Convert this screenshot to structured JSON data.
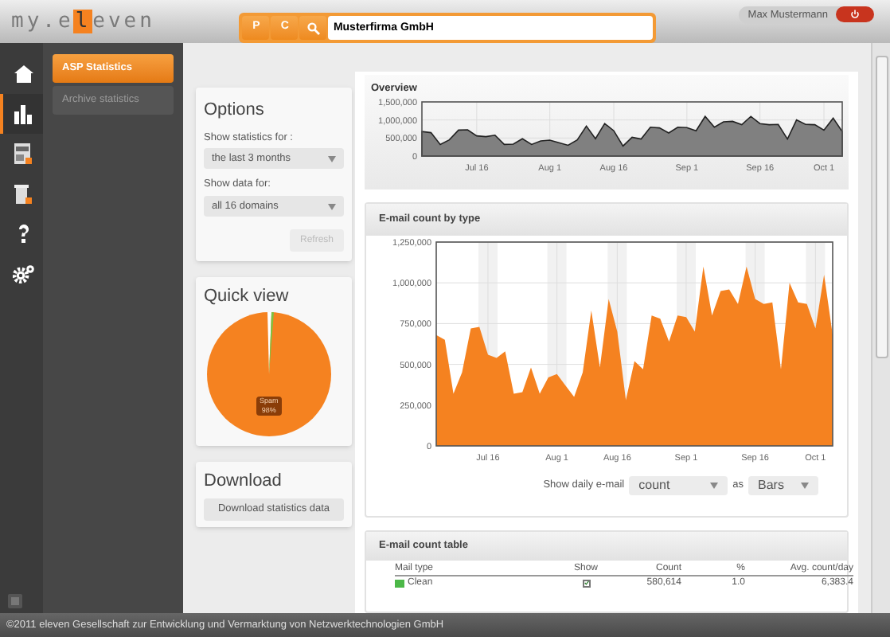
{
  "header": {
    "logo": {
      "before": "my.e",
      "mark": "l",
      "after": "even"
    },
    "search": {
      "buttons": [
        {
          "kind": "text",
          "label": "P"
        },
        {
          "kind": "text",
          "label": "C"
        },
        {
          "kind": "search"
        }
      ],
      "value": "Musterfirma GmbH"
    },
    "user": {
      "name": "Max Mustermann"
    }
  },
  "rail": [
    {
      "kind": "home",
      "selected": false
    },
    {
      "kind": "chart",
      "selected": true
    },
    {
      "kind": "report",
      "selected": false
    },
    {
      "kind": "trash",
      "selected": false
    },
    {
      "kind": "help",
      "selected": false
    },
    {
      "kind": "settings",
      "selected": false
    }
  ],
  "nav": [
    {
      "label": "ASP Statistics",
      "selected": true
    },
    {
      "label": "Archive statistics",
      "selected": false
    }
  ],
  "options": {
    "title": "Options",
    "fields": [
      {
        "label": "Show statistics for :",
        "value": "the last 3 months"
      },
      {
        "label": "Show data for:",
        "value": "all 16 domains"
      }
    ],
    "refresh": {
      "label": "Refresh",
      "disabled": true
    }
  },
  "quick_view": {
    "title": "Quick view",
    "tooltip": [
      "Spam",
      "98%"
    ]
  },
  "download": {
    "title": "Download",
    "button": "Download statistics data"
  },
  "overview": {
    "title": "Overview",
    "chart_data": {
      "type": "area",
      "categories": [
        null,
        null,
        null,
        null,
        null,
        null,
        "Jul 16",
        null,
        null,
        null,
        null,
        null,
        null,
        null,
        "Aug 1",
        null,
        null,
        null,
        null,
        null,
        null,
        "Aug 16",
        null,
        null,
        null,
        null,
        null,
        null,
        null,
        "Sep 1",
        null,
        null,
        null,
        null,
        null,
        null,
        null,
        "Sep 16",
        null,
        null,
        null,
        null,
        null,
        null,
        "Oct 1",
        null,
        null
      ],
      "series": [
        {
          "color": "#808080",
          "values": [
            680000,
            650000,
            320000,
            450000,
            720000,
            730000,
            560000,
            540000,
            580000,
            320000,
            330000,
            480000,
            320000,
            420000,
            440000,
            370000,
            300000,
            450000,
            830000,
            480000,
            900000,
            700000,
            280000,
            520000,
            470000,
            800000,
            780000,
            640000,
            800000,
            790000,
            700000,
            1100000,
            800000,
            950000,
            960000,
            870000,
            1100000,
            900000,
            870000,
            880000,
            470000,
            1000000,
            880000,
            870000,
            720000,
            1050000,
            680000
          ]
        }
      ],
      "ylim": [
        0,
        1500000
      ],
      "grid": true,
      "yticks": [
        {
          "value": 0,
          "label": "0"
        },
        {
          "value": 500000,
          "label": "500,000"
        },
        {
          "value": 1000000,
          "label": "1,000,000"
        },
        {
          "value": 1500000,
          "label": "1,500,000"
        }
      ]
    }
  },
  "count_by_type": {
    "title": "E-mail count by type",
    "chart_data": {
      "type": "area",
      "categories": [
        null,
        null,
        null,
        null,
        null,
        null,
        "Jul 16",
        null,
        null,
        null,
        null,
        null,
        null,
        null,
        "Aug 1",
        null,
        null,
        null,
        null,
        null,
        null,
        "Aug 16",
        null,
        null,
        null,
        null,
        null,
        null,
        null,
        "Sep 1",
        null,
        null,
        null,
        null,
        null,
        null,
        null,
        "Sep 16",
        null,
        null,
        null,
        null,
        null,
        null,
        "Oct 1",
        null,
        null
      ],
      "series": [
        {
          "color": "#f58220",
          "values": [
            680000,
            650000,
            320000,
            450000,
            720000,
            730000,
            560000,
            540000,
            580000,
            320000,
            330000,
            480000,
            320000,
            420000,
            440000,
            370000,
            300000,
            450000,
            830000,
            480000,
            900000,
            700000,
            280000,
            520000,
            470000,
            800000,
            780000,
            640000,
            800000,
            790000,
            700000,
            1100000,
            800000,
            950000,
            960000,
            870000,
            1100000,
            900000,
            870000,
            880000,
            470000,
            1000000,
            880000,
            870000,
            720000,
            1050000,
            680000
          ]
        }
      ],
      "ylim": [
        0,
        1250000
      ],
      "grid": true,
      "yticks": [
        {
          "value": 0,
          "label": "0"
        },
        {
          "value": 250000,
          "label": "250,000"
        },
        {
          "value": 500000,
          "label": "500,000"
        },
        {
          "value": 750000,
          "label": "750,000"
        },
        {
          "value": 1000000,
          "label": "1,000,000"
        },
        {
          "value": 1250000,
          "label": "1,250,000"
        }
      ]
    },
    "controls": {
      "label": "Show daily e-mail",
      "metric": "count",
      "joiner": "as",
      "style": "Bars"
    }
  },
  "count_table": {
    "title": "E-mail count table",
    "columns": [
      "Mail type",
      "Show",
      "Count",
      "%",
      "Avg. count/day"
    ],
    "rows": [
      {
        "type": "Clean",
        "color": "#4cb848",
        "show": true,
        "count": "580,614",
        "percent": "1.0",
        "avg": "6,383.4"
      }
    ]
  },
  "footer": "©2011 eleven Gesellschaft zur Entwicklung und Vermarktung von Netzwerktechnologien GmbH"
}
